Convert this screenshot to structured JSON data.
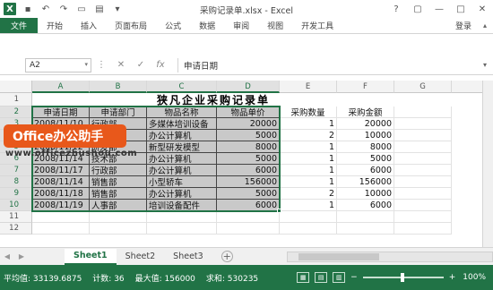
{
  "window": {
    "title": "采购记录单.xlsx - Excel",
    "controls": [
      "?",
      "▢",
      "—",
      "□",
      "✕"
    ]
  },
  "ribbon": {
    "tabs": [
      "文件",
      "开始",
      "插入",
      "页面布局",
      "公式",
      "数据",
      "审阅",
      "视图",
      "开发工具"
    ],
    "login": "登录"
  },
  "formula_bar": {
    "name_box": "A2",
    "formula": "申请日期"
  },
  "sheet": {
    "columns": [
      "A",
      "B",
      "C",
      "D",
      "E",
      "F",
      "G"
    ],
    "rows": [
      "1",
      "2",
      "3",
      "4",
      "5",
      "6",
      "7",
      "8",
      "9",
      "10",
      "11",
      "12"
    ],
    "title": "狭凡企业采购记录单",
    "headers": [
      "申请日期",
      "申请部门",
      "物品名称",
      "物品单价",
      "采购数量",
      "采购金额"
    ],
    "data": [
      [
        "2008/11/10",
        "行政部",
        "多媒体培训设备",
        "20000",
        "1",
        "20000"
      ],
      [
        "2008/11/10",
        "行政部",
        "办公计算机",
        "5000",
        "2",
        "10000"
      ],
      [
        "2008/11/12",
        "研发部",
        "新型研发模型",
        "8000",
        "1",
        "8000"
      ],
      [
        "2008/11/14",
        "技术部",
        "办公计算机",
        "5000",
        "1",
        "5000"
      ],
      [
        "2008/11/17",
        "行政部",
        "办公计算机",
        "6000",
        "1",
        "6000"
      ],
      [
        "2008/11/14",
        "销售部",
        "小型轿车",
        "156000",
        "1",
        "156000"
      ],
      [
        "2008/11/18",
        "销售部",
        "办公计算机",
        "5000",
        "2",
        "10000"
      ],
      [
        "2008/11/19",
        "人事部",
        "培训设备配件",
        "6000",
        "1",
        "6000"
      ]
    ]
  },
  "overlay": {
    "badge": "Office办公助手",
    "url": "www.officezhushou.com"
  },
  "sheet_tabs": [
    "Sheet1",
    "Sheet2",
    "Sheet3"
  ],
  "status": {
    "average": "平均值: 33139.6875",
    "count": "计数: 36",
    "max": "最大值: 156000",
    "sum": "求和: 530235",
    "zoom": "100%"
  }
}
